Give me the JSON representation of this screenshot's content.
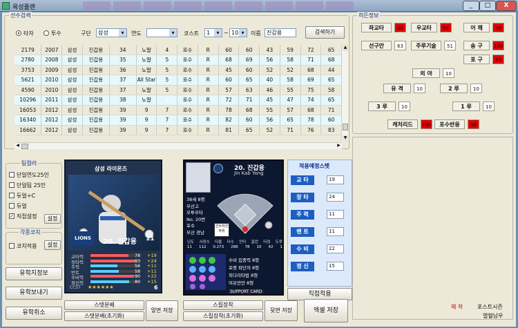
{
  "window": {
    "title": "육성플랜",
    "tabs": [
      "",
      "",
      "",
      "",
      "",
      "",
      "",
      "",
      ""
    ],
    "min": "_",
    "max": "□",
    "close": "X"
  },
  "search": {
    "group_label": "선수검색",
    "radio_batter": "타자",
    "radio_pitcher": "투수",
    "team_label": "구단",
    "team_value": "삼성",
    "year_label": "연도",
    "year_value": "",
    "cost_label": "코스트",
    "cost_from": "1",
    "tilde": "~",
    "cost_to": "10",
    "name_label": "이름",
    "name_value": "진갑용",
    "search_button": "검색하기"
  },
  "table": {
    "rows": [
      [
        "2179",
        "2007",
        "삼성",
        "진갑용",
        "34",
        "노말",
        "4",
        "포수",
        "R",
        "60",
        "60",
        "43",
        "59",
        "72",
        "65"
      ],
      [
        "2780",
        "2008",
        "삼성",
        "진갑용",
        "35",
        "노말",
        "5",
        "포수",
        "R",
        "68",
        "69",
        "56",
        "58",
        "71",
        "68"
      ],
      [
        "3753",
        "2009",
        "삼성",
        "진갑용",
        "36",
        "노말",
        "5",
        "포수",
        "R",
        "45",
        "60",
        "52",
        "52",
        "68",
        "44"
      ],
      [
        "5621",
        "2010",
        "삼성",
        "진갑용",
        "37",
        "All Star",
        "5",
        "포수",
        "R",
        "60",
        "65",
        "40",
        "58",
        "69",
        "65"
      ],
      [
        "4590",
        "2010",
        "삼성",
        "진갑용",
        "37",
        "노말",
        "5",
        "포수",
        "R",
        "57",
        "63",
        "46",
        "55",
        "75",
        "58"
      ],
      [
        "10296",
        "2011",
        "삼성",
        "진갑용",
        "38",
        "노말",
        "6",
        "포수",
        "R",
        "72",
        "71",
        "45",
        "47",
        "74",
        "65"
      ],
      [
        "16053",
        "2012",
        "삼성",
        "진갑용",
        "39",
        "9",
        "7",
        "포수",
        "R",
        "78",
        "68",
        "55",
        "57",
        "68",
        "71"
      ],
      [
        "16340",
        "2012",
        "삼성",
        "진갑용",
        "39",
        "9",
        "7",
        "포수",
        "R",
        "82",
        "60",
        "56",
        "65",
        "78",
        "60"
      ],
      [
        "16662",
        "2012",
        "삼성",
        "진갑용",
        "39",
        "9",
        "7",
        "포수",
        "R",
        "81",
        "65",
        "52",
        "71",
        "76",
        "83"
      ]
    ],
    "highlight_row": 5,
    "highlight_col": 6
  },
  "hidden": {
    "group_label": "히든정보",
    "items": [
      {
        "label": "좌교타",
        "value": "80",
        "red": true
      },
      {
        "label": "우교타",
        "value": "92",
        "red": true
      },
      {
        "label": "어 깨",
        "value": "96",
        "red": true
      },
      {
        "label": "선구안",
        "value": "63",
        "red": false
      },
      {
        "label": "주루기술",
        "value": "51",
        "red": false
      },
      {
        "label": "송 구",
        "value": "100",
        "red": true
      },
      {
        "label": "포 구",
        "value": "93",
        "red": true
      },
      {
        "label": "외 야",
        "value": "10",
        "red": false
      },
      {
        "label": "유 격",
        "value": "10",
        "red": false
      },
      {
        "label": "2 루",
        "value": "10",
        "red": false
      },
      {
        "label": "3 루",
        "value": "10",
        "red": false
      },
      {
        "label": "1 루",
        "value": "10",
        "red": false
      },
      {
        "label": "캐처리드",
        "value": "100",
        "red": true
      },
      {
        "label": "포수반응",
        "value": "88",
        "red": true
      }
    ]
  },
  "team_color": {
    "group_label": "팀컬러",
    "items": [
      {
        "label": "단일연도25인",
        "checked": false
      },
      {
        "label": "단일팀 25인",
        "checked": false
      },
      {
        "label": "듀얼+C",
        "checked": false
      },
      {
        "label": "듀얼",
        "checked": false
      },
      {
        "label": "직접설정",
        "checked": true
      }
    ],
    "set_button": "설정"
  },
  "coach": {
    "group_label": "각종코치",
    "item": "코치적용",
    "set_button": "설정"
  },
  "left_buttons": {
    "dev_info": "유학지정보",
    "send": "유학보내기",
    "cancel": "유학취소"
  },
  "card_front": {
    "team": "삼성 라이온즈",
    "logo": "LIONS",
    "name": "20. 진갑용",
    "grade": "11",
    "stats": [
      {
        "label": "교타력",
        "value": "78",
        "plus": "+19"
      },
      {
        "label": "장타력",
        "value": "93",
        "plus": "+24"
      },
      {
        "label": "주력",
        "value": "56",
        "plus": "+11"
      },
      {
        "label": "번트",
        "value": "58",
        "plus": "+11"
      },
      {
        "label": "수비력",
        "value": "90",
        "plus": "+22"
      },
      {
        "label": "정신력",
        "value": "80",
        "plus": "+15"
      }
    ],
    "footer_left": "CCST",
    "footer_right": "6"
  },
  "card_back": {
    "name": "20. 진갑용",
    "name_en": "Jin Kab Yong",
    "info": [
      "38세 8명",
      "부산고",
      "우투우타",
      "No. 20번",
      "포수",
      "부산 경남"
    ],
    "tag1": "선수자선",
    "tag2": "하위",
    "stat_headers": [
      "년도",
      "사장수",
      "타율",
      "타수",
      "안타",
      "홈런",
      "타점",
      "도루"
    ],
    "stat_values": [
      "11",
      "112",
      "0.273",
      "286",
      "78",
      "10",
      "42",
      "1"
    ],
    "skills": [
      "수비 집중력 8형",
      "포병 파단자 8형",
      "외다리타법 8형",
      "여유만만 8형"
    ],
    "support": "SUPPORT CARD"
  },
  "apply_stats": {
    "title": "적용예정스텟",
    "items": [
      {
        "label": "교 타",
        "value": "19"
      },
      {
        "label": "장 타",
        "value": "24"
      },
      {
        "label": "주 력",
        "value": "11"
      },
      {
        "label": "밴 트",
        "value": "11"
      },
      {
        "label": "수 비",
        "value": "22"
      },
      {
        "label": "정 신",
        "value": "15"
      }
    ],
    "apply_button": "직접적용"
  },
  "bottom": {
    "stat_alloc": "스텟분배",
    "stat_alloc_init": "스텟분배(초기화)",
    "front_save": "앞면 저장",
    "skill_equip": "스킬장착",
    "skill_equip_init": "스킬장착(초기화)",
    "back_save": "뒷면 저장",
    "excel_save": "엑셀 저장"
  },
  "credit": {
    "label": "제 작",
    "author": "포스트시즌",
    "sub": "열혈남우"
  }
}
